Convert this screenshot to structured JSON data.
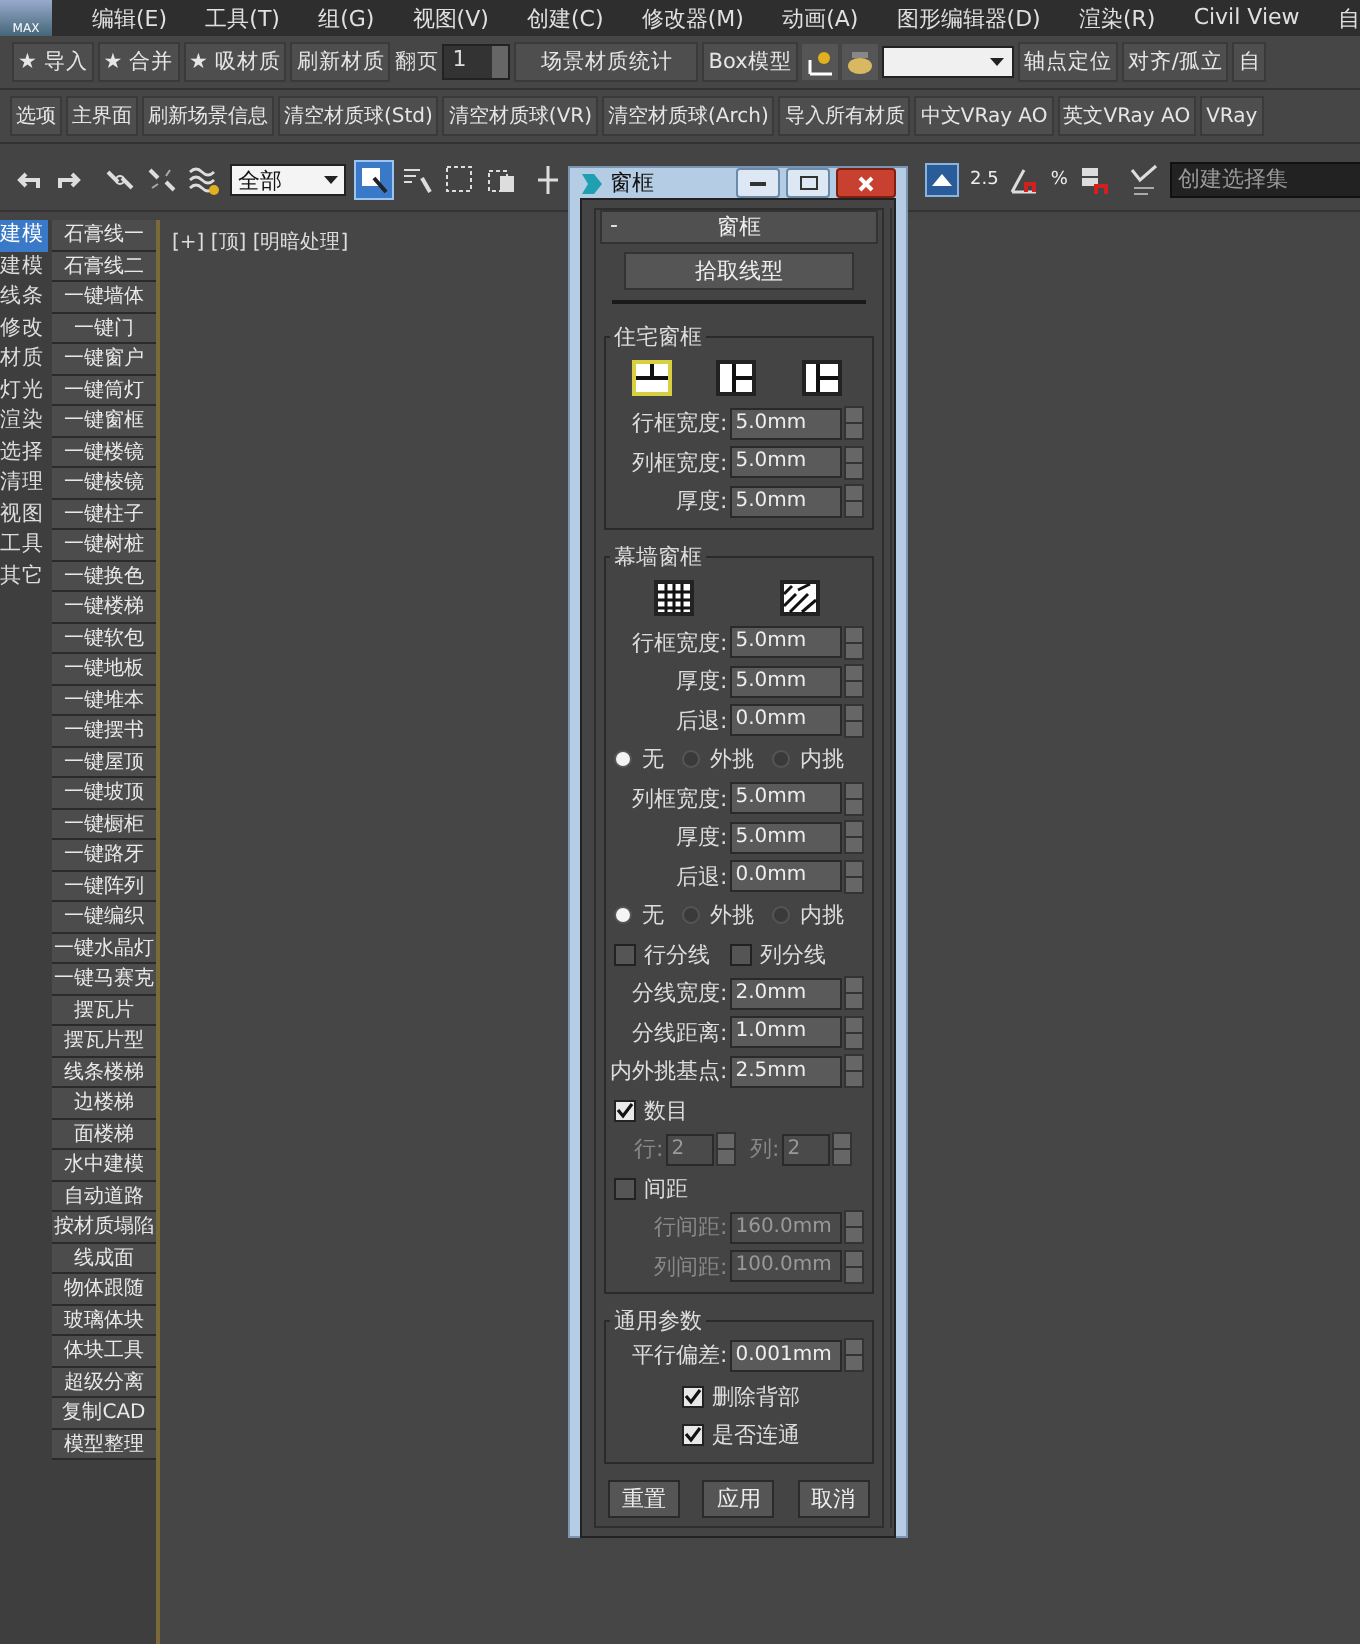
{
  "menu_bar": {
    "logo": "MAX",
    "items": [
      "编辑(E)",
      "工具(T)",
      "组(G)",
      "视图(V)",
      "创建(C)",
      "修改器(M)",
      "动画(A)",
      "图形编辑器(D)",
      "渲染(R)",
      "Civil View",
      "自"
    ]
  },
  "toolbar_1": {
    "items": [
      {
        "kind": "button",
        "label": "★ 导入"
      },
      {
        "kind": "button",
        "label": "★ 合并"
      },
      {
        "kind": "button",
        "label": "★ 吸材质"
      },
      {
        "kind": "button",
        "label": "刷新材质"
      },
      {
        "kind": "label",
        "label": "翻页"
      },
      {
        "kind": "spinner",
        "value": "1"
      },
      {
        "kind": "wide",
        "label": "场景材质统计"
      },
      {
        "kind": "button",
        "label": "Box模型"
      },
      {
        "kind": "pivot_icon"
      },
      {
        "kind": "teapot_icon"
      },
      {
        "kind": "dropdown"
      },
      {
        "kind": "button",
        "label": "轴点定位"
      },
      {
        "kind": "button",
        "label": "对齐/孤立"
      },
      {
        "kind": "button",
        "label": "自"
      }
    ]
  },
  "toolbar_2": {
    "items": [
      "选项",
      "主界面",
      "刷新场景信息",
      "清空材质球(Std)",
      "清空材质球(VR)",
      "清空材质球(Arch)",
      "导入所有材质",
      "中文VRay AO",
      "英文VRay AO",
      "VRay"
    ]
  },
  "toolbar_3": {
    "selection_filter": "全部",
    "select_mode_on": true,
    "snap_label": "2.5",
    "percent_label": "%",
    "named_selection": "创建选择集"
  },
  "left_panel": {
    "categories": [
      {
        "label": "建模",
        "selected": true
      },
      {
        "label": "建模",
        "selected": false
      },
      {
        "label": "线条",
        "selected": false
      },
      {
        "label": "修改",
        "selected": false
      },
      {
        "label": "材质",
        "selected": false
      },
      {
        "label": "灯光",
        "selected": false
      },
      {
        "label": "渲染",
        "selected": false
      },
      {
        "label": "选择",
        "selected": false
      },
      {
        "label": "清理",
        "selected": false
      },
      {
        "label": "视图",
        "selected": false
      },
      {
        "label": "工具",
        "selected": false
      },
      {
        "label": "其它",
        "selected": false
      }
    ],
    "tools": [
      "石膏线一",
      "石膏线二",
      "一键墙体",
      "一键门",
      "一键窗户",
      "一键筒灯",
      "一键窗框",
      "一键楼镜",
      "一键棱镜",
      "一键柱子",
      "一键树桩",
      "一键换色",
      "一键楼梯",
      "一键软包",
      "一键地板",
      "一键堆本",
      "一键摆书",
      "一键屋顶",
      "一键坡顶",
      "一键橱柜",
      "一键路牙",
      "一键阵列",
      "一键编织",
      "一键水晶灯",
      "一键马赛克",
      "摆瓦片",
      "摆瓦片型",
      "线条楼梯",
      "边楼梯",
      "面楼梯",
      "水中建模",
      "自动道路",
      "按材质塌陷",
      "线成面",
      "物体跟随",
      "玻璃体块",
      "体块工具",
      "超级分离",
      "复制CAD",
      "模型整理"
    ]
  },
  "viewport": {
    "label": "[+] [顶] [明暗处理]"
  },
  "dialog": {
    "title": "窗框",
    "rollout_title": "窗框",
    "collapse_mark": "-",
    "pick_button": "拾取线型",
    "groups": [
      {
        "title": "住宅窗框",
        "rows": [
          {
            "kind": "types",
            "options": [
              {
                "selected": true
              },
              {
                "selected": false
              },
              {
                "selected": false
              }
            ]
          },
          {
            "kind": "field",
            "label": "行框宽度:",
            "value": "5.0mm",
            "disabled": false
          },
          {
            "kind": "field",
            "label": "列框宽度:",
            "value": "5.0mm",
            "disabled": false
          },
          {
            "kind": "field",
            "label": "厚度:",
            "value": "5.0mm",
            "disabled": false
          }
        ]
      },
      {
        "title": "幕墙窗框",
        "rows": [
          {
            "kind": "types",
            "options": [
              {
                "selected": false
              },
              {
                "selected": false
              }
            ]
          },
          {
            "kind": "field",
            "label": "行框宽度:",
            "value": "5.0mm",
            "disabled": false
          },
          {
            "kind": "field",
            "label": "厚度:",
            "value": "5.0mm",
            "disabled": false
          },
          {
            "kind": "field",
            "label": "后退:",
            "value": "0.0mm",
            "disabled": false
          },
          {
            "kind": "radios",
            "options": [
              {
                "label": "无",
                "selected": true
              },
              {
                "label": "外挑",
                "selected": false
              },
              {
                "label": "内挑",
                "selected": false
              }
            ]
          },
          {
            "kind": "field",
            "label": "列框宽度:",
            "value": "5.0mm",
            "disabled": false
          },
          {
            "kind": "field",
            "label": "厚度:",
            "value": "5.0mm",
            "disabled": false
          },
          {
            "kind": "field",
            "label": "后退:",
            "value": "0.0mm",
            "disabled": false
          },
          {
            "kind": "radios",
            "options": [
              {
                "label": "无",
                "selected": true
              },
              {
                "label": "外挑",
                "selected": false
              },
              {
                "label": "内挑",
                "selected": false
              }
            ]
          },
          {
            "kind": "checks",
            "options": [
              {
                "label": "行分线",
                "checked": false
              },
              {
                "label": "列分线",
                "checked": false
              }
            ]
          },
          {
            "kind": "field",
            "label": "分线宽度:",
            "value": "2.0mm",
            "disabled": false
          },
          {
            "kind": "field",
            "label": "分线距离:",
            "value": "1.0mm",
            "disabled": false
          },
          {
            "kind": "field",
            "label": "内外挑基点:",
            "value": "2.5mm",
            "disabled": false
          },
          {
            "kind": "checks",
            "options": [
              {
                "label": "数目",
                "checked": true
              }
            ]
          },
          {
            "kind": "pair",
            "disabled": true,
            "items": [
              {
                "label": "行:",
                "value": "2"
              },
              {
                "label": "列:",
                "value": "2"
              }
            ]
          },
          {
            "kind": "checks",
            "options": [
              {
                "label": "间距",
                "checked": false
              }
            ]
          },
          {
            "kind": "field",
            "label": "行间距:",
            "value": "160.0mm",
            "disabled": true
          },
          {
            "kind": "field",
            "label": "列间距:",
            "value": "100.0mm",
            "disabled": true
          }
        ]
      },
      {
        "title": "通用参数",
        "rows": [
          {
            "kind": "field",
            "label": "平行偏差:",
            "value": "0.001mm",
            "disabled": false
          },
          {
            "kind": "centerchecks",
            "options": [
              {
                "label": "删除背部",
                "checked": true
              },
              {
                "label": "是否连通",
                "checked": true
              }
            ]
          }
        ]
      }
    ],
    "buttons": [
      "重置",
      "应用",
      "取消"
    ]
  }
}
